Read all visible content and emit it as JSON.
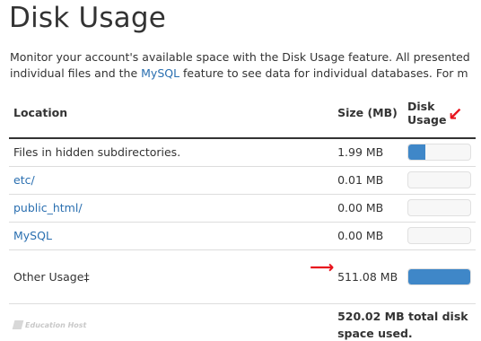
{
  "page": {
    "title": "Disk Usage",
    "description_line1": "Monitor your account's available space with the Disk Usage feature. All presented",
    "description_line2_a": "individual files and the ",
    "description_line2_link": "MySQL",
    "description_line2_b": " feature to see data for individual databases. For m"
  },
  "table": {
    "headers": {
      "location": "Location",
      "size": "Size (MB)",
      "usage_line1": "Disk",
      "usage_line2": "Usage"
    },
    "rows": [
      {
        "location": "Files in hidden subdirectories.",
        "size": "1.99 MB",
        "usage_fraction": 0.27
      },
      {
        "location": "etc/",
        "size": "0.01 MB",
        "usage_fraction": 0
      },
      {
        "location": "public_html/",
        "size": "0.00 MB",
        "usage_fraction": 0
      },
      {
        "location": "MySQL",
        "size": "0.00 MB",
        "usage_fraction": 0
      },
      {
        "location": "Other Usage‡",
        "size": "511.08 MB",
        "usage_fraction": 1
      }
    ],
    "total": "520.02 MB total disk space used."
  },
  "watermark": "Education Host",
  "colors": {
    "bar_fill": "#3f87c8",
    "link": "#2a6fb0",
    "annotation_arrow": "#e8141d"
  }
}
